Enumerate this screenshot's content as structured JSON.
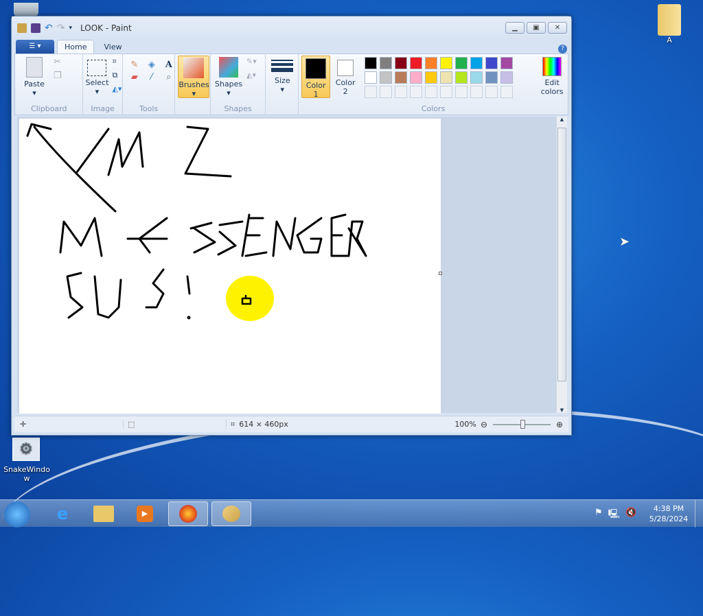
{
  "window": {
    "title": "LOOK - Paint"
  },
  "tabs": [
    {
      "label": "Home"
    },
    {
      "label": "View"
    }
  ],
  "ribbon": {
    "clipboard": {
      "paste": "Paste",
      "group": "Clipboard"
    },
    "image": {
      "select": "Select",
      "group": "Image"
    },
    "tools": {
      "group": "Tools"
    },
    "brushes": {
      "label": "Brushes"
    },
    "shapes": {
      "label": "Shapes",
      "group": "Shapes"
    },
    "size": {
      "label": "Size"
    },
    "color1": {
      "label": "Color",
      "num": "1",
      "value": "#000000"
    },
    "color2": {
      "label": "Color",
      "num": "2",
      "value": "#ffffff"
    },
    "colors": {
      "group": "Colors",
      "edit1": "Edit",
      "edit2": "colors",
      "palette": [
        "#000000",
        "#7f7f7f",
        "#880015",
        "#ed1c24",
        "#ff7f27",
        "#fff200",
        "#22b14c",
        "#00a2e8",
        "#3f48cc",
        "#a349a4",
        "#ffffff",
        "#c3c3c3",
        "#b97a57",
        "#ffaec9",
        "#ffc90e",
        "#efe4b0",
        "#b5e61d",
        "#99d9ea",
        "#7092be",
        "#c8bfe7"
      ]
    }
  },
  "status": {
    "dimensions": "614 × 460px",
    "zoom": "100%"
  },
  "desktop": {
    "folder_label": "A",
    "app_label": "SnakeWindow"
  },
  "tray": {
    "time": "4:38 PM",
    "date": "5/28/2024"
  }
}
